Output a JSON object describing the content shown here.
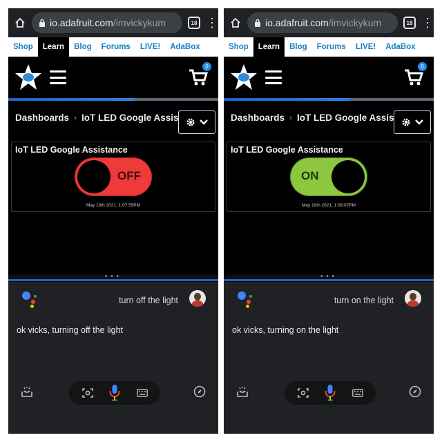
{
  "panels": [
    {
      "browser": {
        "url_host": "io.adafruit.com",
        "url_path": "/imvickykum",
        "tab_count": "18"
      },
      "nav": [
        "Shop",
        "Learn",
        "Blog",
        "Forums",
        "LIVE!",
        "AdaBox"
      ],
      "cart_count": "0",
      "breadcrumb": {
        "root": "Dashboards",
        "current": "IoT LED Google Assistance"
      },
      "widget": {
        "title": "IoT LED Google Assistance",
        "state": "OFF",
        "timestamp": "May 10th 2021, 1:07:55PM"
      },
      "assistant": {
        "query": "turn off the light",
        "reply": "ok vicks, turning off the light"
      }
    },
    {
      "browser": {
        "url_host": "io.adafruit.com",
        "url_path": "/imvickykum",
        "tab_count": "18"
      },
      "nav": [
        "Shop",
        "Learn",
        "Blog",
        "Forums",
        "LIVE!",
        "AdaBox"
      ],
      "cart_count": "0",
      "breadcrumb": {
        "root": "Dashboards",
        "current": "IoT LED Google Assistance"
      },
      "widget": {
        "title": "IoT LED Google Assistance",
        "state": "ON",
        "timestamp": "May 10th 2021, 1:08:07PM"
      },
      "assistant": {
        "query": "turn on the light",
        "reply": "ok vicks, turning on the light"
      }
    }
  ],
  "colors": {
    "toggle_off": "#ef3a3a",
    "toggle_on": "#8dc63f",
    "nav_link": "#1a7fc1",
    "accent_blue": "#1f63c8"
  },
  "icons": [
    "home-icon",
    "lock-icon",
    "tabs-icon",
    "overflow-menu-icon",
    "adafruit-logo",
    "hamburger-icon",
    "cart-icon",
    "gear-icon",
    "chevron-down-icon",
    "google-assistant-logo",
    "snapshot-icon",
    "lens-icon",
    "mic-icon",
    "keyboard-icon",
    "compass-icon"
  ]
}
